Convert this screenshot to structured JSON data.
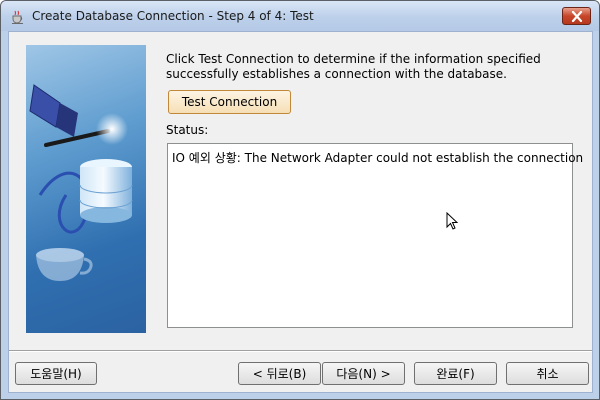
{
  "window": {
    "title": "Create Database Connection - Step 4 of 4: Test"
  },
  "content": {
    "instruction": "Click Test Connection to determine if the information specified successfully establishes a connection with the database.",
    "test_button_label": "Test Connection",
    "status_label": "Status:",
    "status_text": "IO 예외 상황: The Network Adapter could not establish the connection"
  },
  "buttons": {
    "help": "도움말(H)",
    "back": "< 뒤로(B)",
    "next": "다음(N) >",
    "finish": "완료(F)",
    "cancel": "취소"
  },
  "colors": {
    "titlebar": "#bcd0ea",
    "dialog_bg": "#f0f0f0",
    "test_button": "#f6dfb6",
    "close_button": "#c7462a"
  }
}
